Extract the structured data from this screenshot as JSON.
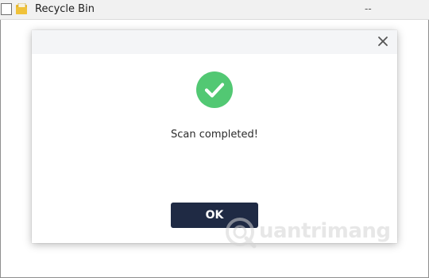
{
  "file_row": {
    "name": "Recycle Bin",
    "size": "--"
  },
  "dialog": {
    "message": "Scan completed!",
    "ok_label": "OK"
  },
  "watermark": {
    "text": "uantrimang"
  },
  "colors": {
    "success": "#52c873",
    "button": "#1f2a44",
    "folder": "#e8b830"
  },
  "icons": [
    "folder-icon",
    "close-icon",
    "check-circle-icon"
  ]
}
